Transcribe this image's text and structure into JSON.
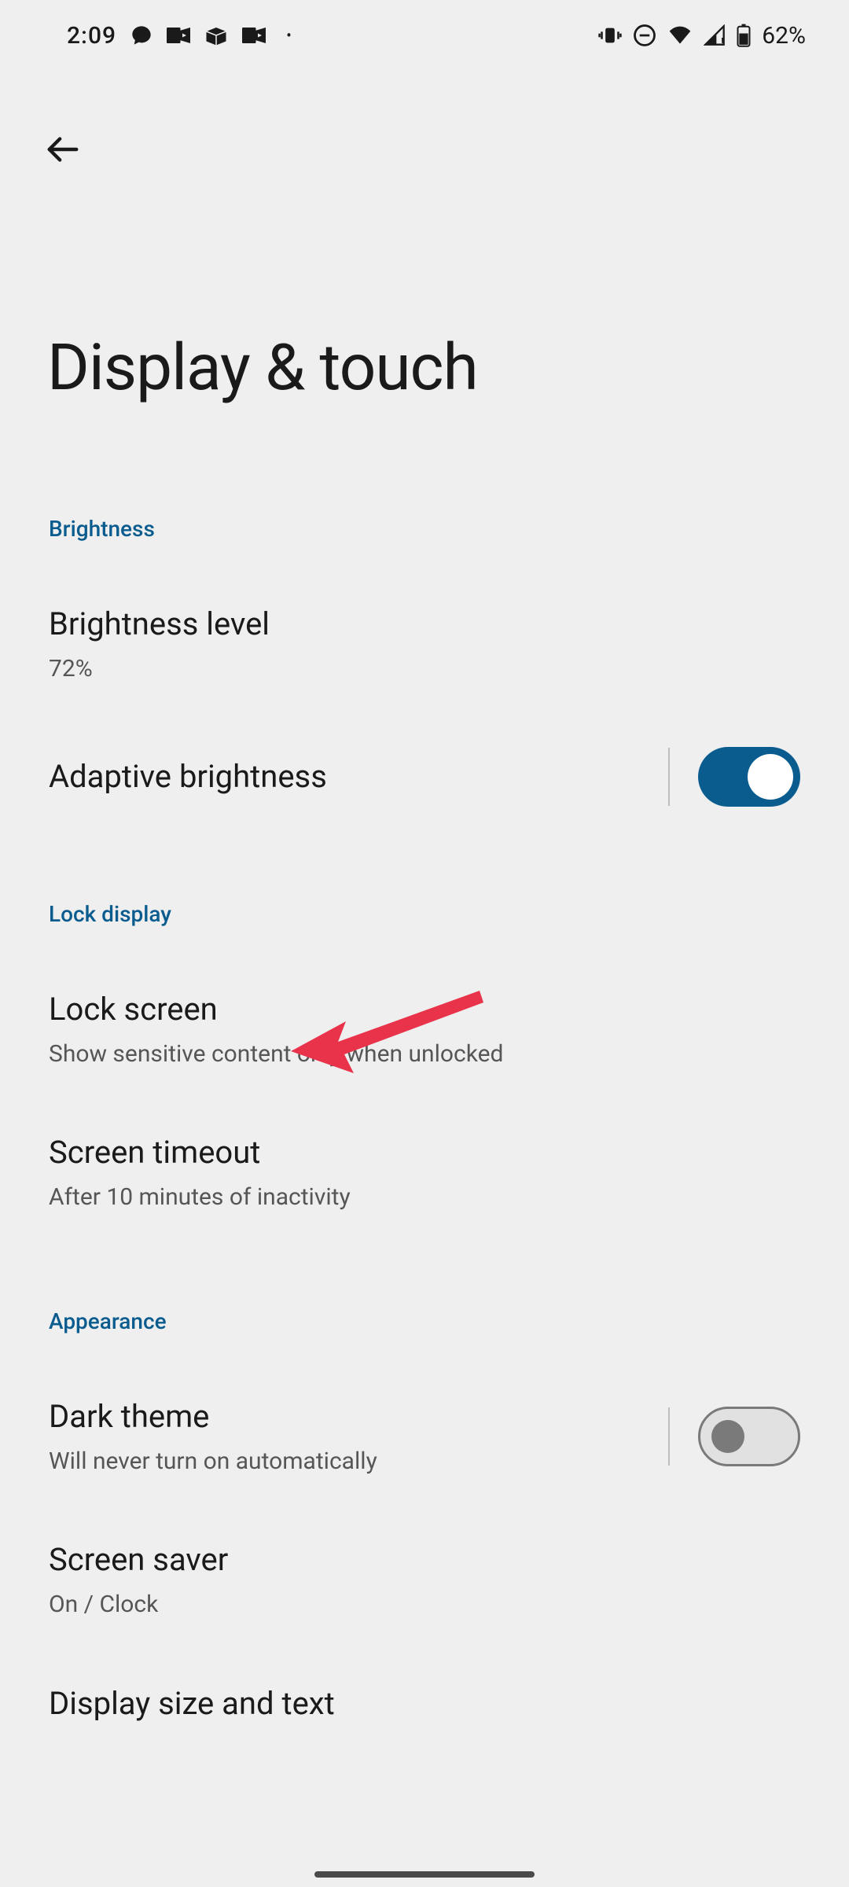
{
  "status": {
    "time": "2:09",
    "battery": "62%"
  },
  "page": {
    "title": "Display & touch"
  },
  "sections": {
    "brightness": {
      "header": "Brightness",
      "level": {
        "title": "Brightness level",
        "value": "72%"
      },
      "adaptive": {
        "title": "Adaptive brightness",
        "on": true
      }
    },
    "lockdisplay": {
      "header": "Lock display",
      "lockscreen": {
        "title": "Lock screen",
        "subtitle": "Show sensitive content only when unlocked"
      },
      "timeout": {
        "title": "Screen timeout",
        "subtitle": "After 10 minutes of inactivity"
      }
    },
    "appearance": {
      "header": "Appearance",
      "darktheme": {
        "title": "Dark theme",
        "subtitle": "Will never turn on automatically",
        "on": false
      },
      "screensaver": {
        "title": "Screen saver",
        "subtitle": "On / Clock"
      },
      "displaysize": {
        "title": "Display size and text"
      }
    }
  },
  "annotation": {
    "arrow_color": "#e9334a"
  }
}
